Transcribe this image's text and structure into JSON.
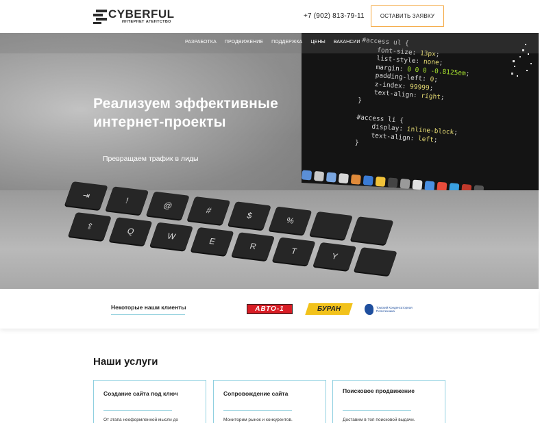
{
  "header": {
    "logo_name": "CYBERFUL",
    "logo_sub": "ИНТЕРНЕТ АГЕНТСТВО",
    "phone": "+7 (902) 813-79-11",
    "cta_label": "ОСТАВИТЬ ЗАЯВКУ"
  },
  "nav": {
    "items": [
      "РАЗРАБОТКА",
      "ПРОДВИЖЕНИЕ",
      "ПОДДЕРЖКА",
      "ЦЕНЫ",
      "ВАКАНСИИ"
    ]
  },
  "hero": {
    "title": "Реализуем  эффективные интернет-проекты",
    "subtitle": "Превращаем трафик в лиды"
  },
  "clients": {
    "title": "Некоторые наши клиенты",
    "logos": [
      "АВТО-1",
      "БУРАН",
      "Томский Конденсаторная Политехника"
    ]
  },
  "services": {
    "title": "Наши услуги",
    "cards": [
      {
        "title": "Создание сайта под ключ",
        "text": "От этапа неоформленной мысли до"
      },
      {
        "title": "Сопровождение сайта",
        "text": "Мониторим рынок и конкурентов."
      },
      {
        "title": "Поисковое продвижение",
        "text": "Доставим в топ поисковой выдачи."
      }
    ]
  },
  "colors": {
    "accent": "#f4a53a",
    "line": "#9bd4e0"
  }
}
